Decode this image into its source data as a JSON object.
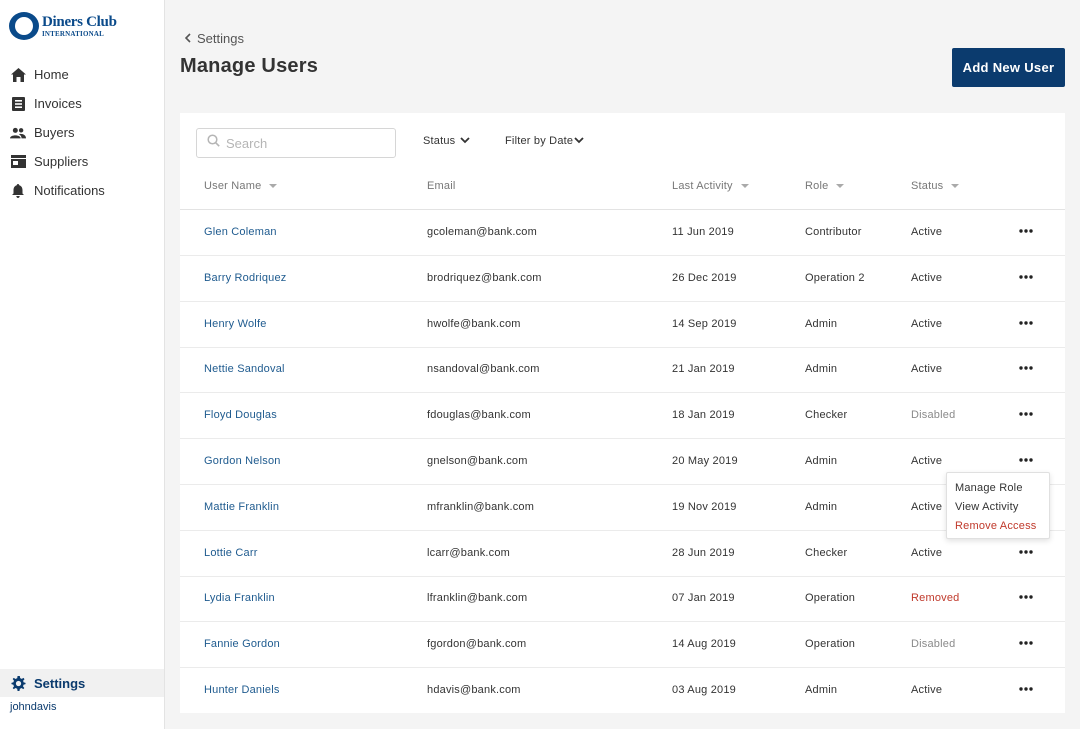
{
  "brand": {
    "name": "Diners Club",
    "sub": "INTERNATIONAL",
    "color": "#0a4a8a"
  },
  "sidebar": {
    "items": [
      {
        "label": "Home",
        "icon": "home-icon"
      },
      {
        "label": "Invoices",
        "icon": "invoice-icon"
      },
      {
        "label": "Buyers",
        "icon": "buyers-icon"
      },
      {
        "label": "Suppliers",
        "icon": "suppliers-icon"
      },
      {
        "label": "Notifications",
        "icon": "bell-icon"
      }
    ],
    "settings_label": "Settings",
    "username": "johndavis"
  },
  "header": {
    "breadcrumb": "Settings",
    "title": "Manage Users",
    "add_button": "Add New User"
  },
  "toolbar": {
    "search_placeholder": "Search",
    "status_filter": "Status",
    "date_filter": "Filter by Date"
  },
  "table": {
    "columns": [
      "User Name",
      "Email",
      "Last Activity",
      "Role",
      "Status"
    ],
    "rows": [
      {
        "name": "Glen Coleman",
        "email": "gcoleman@bank.com",
        "date": "11 Jun 2019",
        "role": "Contributor",
        "status": "Active"
      },
      {
        "name": "Barry Rodriquez",
        "email": "brodriquez@bank.com",
        "date": "26 Dec 2019",
        "role": "Operation 2",
        "status": "Active"
      },
      {
        "name": "Henry Wolfe",
        "email": "hwolfe@bank.com",
        "date": "14 Sep 2019",
        "role": "Admin",
        "status": "Active"
      },
      {
        "name": "Nettie Sandoval",
        "email": "nsandoval@bank.com",
        "date": "21 Jan 2019",
        "role": "Admin",
        "status": "Active"
      },
      {
        "name": "Floyd Douglas",
        "email": "fdouglas@bank.com",
        "date": "18 Jan 2019",
        "role": "Checker",
        "status": "Disabled"
      },
      {
        "name": "Gordon Nelson",
        "email": "gnelson@bank.com",
        "date": "20 May 2019",
        "role": "Admin",
        "status": "Active"
      },
      {
        "name": "Mattie Franklin",
        "email": "mfranklin@bank.com",
        "date": "19 Nov 2019",
        "role": "Admin",
        "status": "Active"
      },
      {
        "name": "Lottie Carr",
        "email": "lcarr@bank.com",
        "date": "28 Jun 2019",
        "role": "Checker",
        "status": "Active"
      },
      {
        "name": "Lydia Franklin",
        "email": "lfranklin@bank.com",
        "date": "07 Jan 2019",
        "role": "Operation",
        "status": "Removed"
      },
      {
        "name": "Fannie Gordon",
        "email": "fgordon@bank.com",
        "date": "14 Aug 2019",
        "role": "Operation",
        "status": "Disabled"
      },
      {
        "name": "Hunter Daniels",
        "email": "hdavis@bank.com",
        "date": "03 Aug 2019",
        "role": "Admin",
        "status": "Active"
      }
    ]
  },
  "row_menu": {
    "items": [
      "Manage Role",
      "View Activity",
      "Remove Access"
    ]
  },
  "colors": {
    "primary": "#0b3b6e",
    "link": "#1f5b8f",
    "removed": "#c0392b",
    "disabled": "#8a8a8a"
  }
}
